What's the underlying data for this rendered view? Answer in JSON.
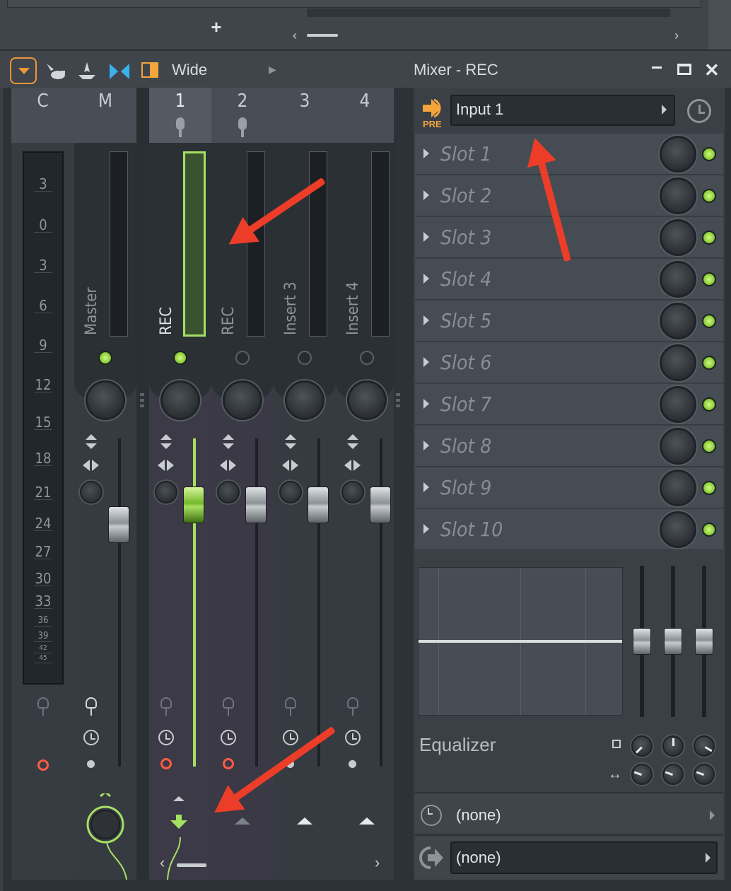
{
  "toolbar": {
    "width_mode": "Wide",
    "title": "Mixer - REC"
  },
  "meter_scale": [
    "3",
    "0",
    "3",
    "6",
    "9",
    "12",
    "15",
    "18",
    "21",
    "24",
    "27",
    "30",
    "33",
    "36",
    "39",
    "42",
    "45"
  ],
  "strips": [
    {
      "id": "C",
      "label": "C",
      "name": ""
    },
    {
      "id": "M",
      "label": "M",
      "name": "Master"
    },
    {
      "id": "1",
      "label": "1",
      "name": "REC"
    },
    {
      "id": "2",
      "label": "2",
      "name": "REC"
    },
    {
      "id": "3",
      "label": "3",
      "name": "Insert 3"
    },
    {
      "id": "4",
      "label": "4",
      "name": "Insert 4"
    }
  ],
  "panel": {
    "pre_label": "PRE",
    "input_value": "Input 1",
    "slots": [
      "Slot 1",
      "Slot 2",
      "Slot 3",
      "Slot 4",
      "Slot 5",
      "Slot 6",
      "Slot 7",
      "Slot 8",
      "Slot 9",
      "Slot 10"
    ],
    "eq_label": "Equalizer",
    "time_value": "(none)",
    "output_value": "(none)"
  },
  "colors": {
    "accent_orange": "#f0953a",
    "led_green": "#8ed13a",
    "record_red": "#ff5a45",
    "annotation_red": "#ec3d29"
  }
}
